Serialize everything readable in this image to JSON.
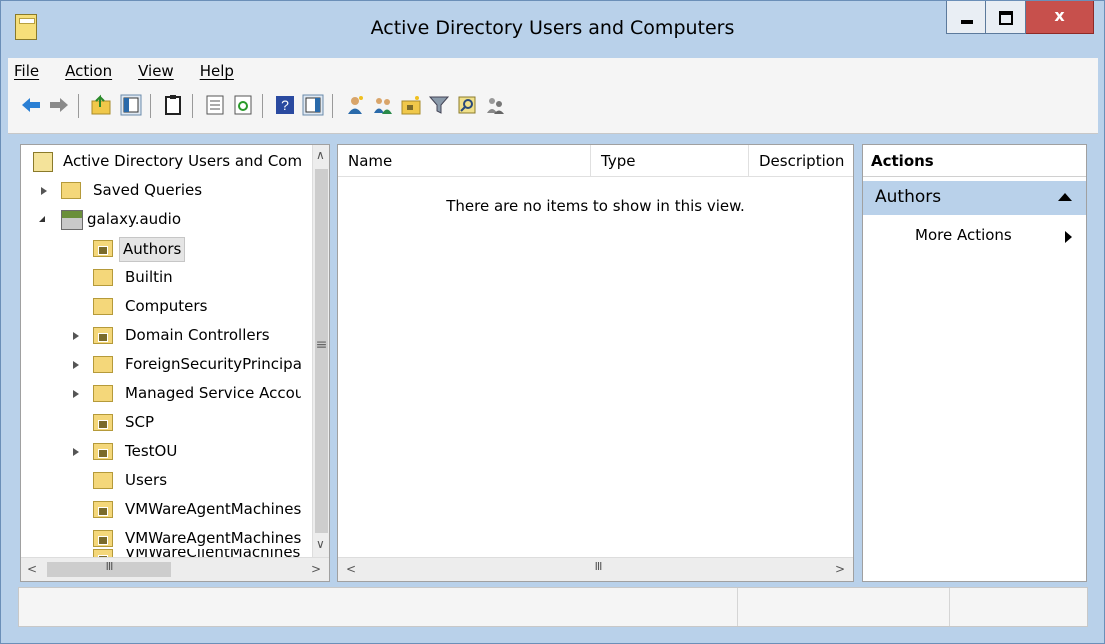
{
  "window": {
    "title": "Active Directory Users and Computers",
    "close_glyph": "x"
  },
  "menu": [
    {
      "label": "File"
    },
    {
      "label": "Action"
    },
    {
      "label": "View"
    },
    {
      "label": "Help"
    }
  ],
  "toolbar": {
    "buttons": [
      "back-arrow-icon",
      "forward-arrow-icon",
      "up-folder-icon",
      "show-hide-console-tree-icon",
      "clipboard-icon",
      "properties-icon",
      "refresh-icon",
      "help-icon",
      "show-hide-action-pane-icon",
      "create-user-icon",
      "create-group-icon",
      "create-ou-icon",
      "filter-icon",
      "find-icon",
      "delegate-icon"
    ]
  },
  "tree": {
    "root": "Active Directory Users and Computers",
    "items": [
      {
        "label": "Saved Queries",
        "level": 1,
        "expander": "closed"
      },
      {
        "label": "galaxy.audio",
        "level": 1,
        "expander": "open"
      },
      {
        "label": "Authors",
        "level": 2,
        "selected": true,
        "ou": true
      },
      {
        "label": "Builtin",
        "level": 2
      },
      {
        "label": "Computers",
        "level": 2
      },
      {
        "label": "Domain Controllers",
        "level": 2,
        "expander": "closed",
        "ou": true
      },
      {
        "label": "ForeignSecurityPrincipals",
        "level": 2,
        "expander": "closed"
      },
      {
        "label": "Managed Service Accounts",
        "level": 2,
        "expander": "closed"
      },
      {
        "label": "SCP",
        "level": 2,
        "ou": true
      },
      {
        "label": "TestOU",
        "level": 2,
        "expander": "closed",
        "ou": true
      },
      {
        "label": "Users",
        "level": 2
      },
      {
        "label": "VMWareAgentMachines",
        "level": 2,
        "ou": true
      },
      {
        "label": "VMWareAgentMachines",
        "level": 2,
        "ou": true
      },
      {
        "label": "VMWareClientMachines",
        "level": 2,
        "ou": true
      }
    ],
    "scrollbar_thumb_glyph": "≡",
    "hscroll_thumb_glyph": "III"
  },
  "list": {
    "columns": [
      "Name",
      "Type",
      "Description"
    ],
    "empty_message": "There are no items to show in this view."
  },
  "actions": {
    "header": "Actions",
    "section": "Authors",
    "items": [
      {
        "label": "More Actions"
      }
    ]
  },
  "colors": {
    "frame": "#b9d1ea",
    "close_button": "#c7504c",
    "folder": "#f4d77a"
  }
}
